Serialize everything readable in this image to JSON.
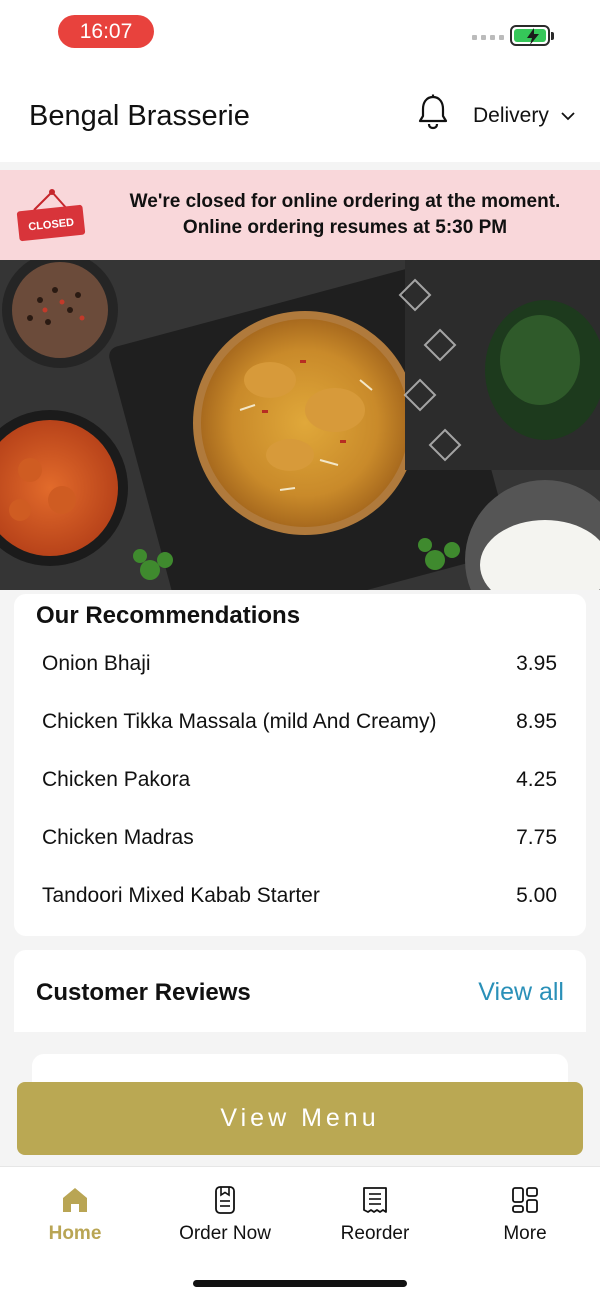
{
  "status_bar": {
    "time": "16:07"
  },
  "header": {
    "title": "Bengal Brasserie",
    "delivery_label": "Delivery"
  },
  "closed_banner": {
    "sign_text": "CLOSED",
    "line1": "We're closed for online ordering at the moment.",
    "line2": "Online ordering resumes at 5:30 PM"
  },
  "recommendations": {
    "title": "Our Recommendations",
    "items": [
      {
        "name": "Onion Bhaji",
        "price": "3.95"
      },
      {
        "name": "Chicken Tikka Massala (mild And Creamy)",
        "price": "8.95"
      },
      {
        "name": "Chicken Pakora",
        "price": "4.25"
      },
      {
        "name": "Chicken Madras",
        "price": "7.75"
      },
      {
        "name": "Tandoori Mixed Kabab Starter",
        "price": "5.00"
      }
    ]
  },
  "reviews": {
    "title": "Customer Reviews",
    "view_all": "View all"
  },
  "view_menu_button": "View Menu",
  "tabbar": {
    "home": "Home",
    "order_now": "Order Now",
    "reorder": "Reorder",
    "more": "More"
  },
  "colors": {
    "accent_gold": "#baa853",
    "link_blue": "#2a90b8",
    "closed_banner_bg": "#f9d7da",
    "time_pill_red": "#e8423d"
  },
  "icons": [
    "bell-icon",
    "chevron-down-icon",
    "closed-sign-icon",
    "home-icon",
    "order-now-icon",
    "reorder-receipt-icon",
    "more-grid-icon",
    "battery-icon"
  ]
}
